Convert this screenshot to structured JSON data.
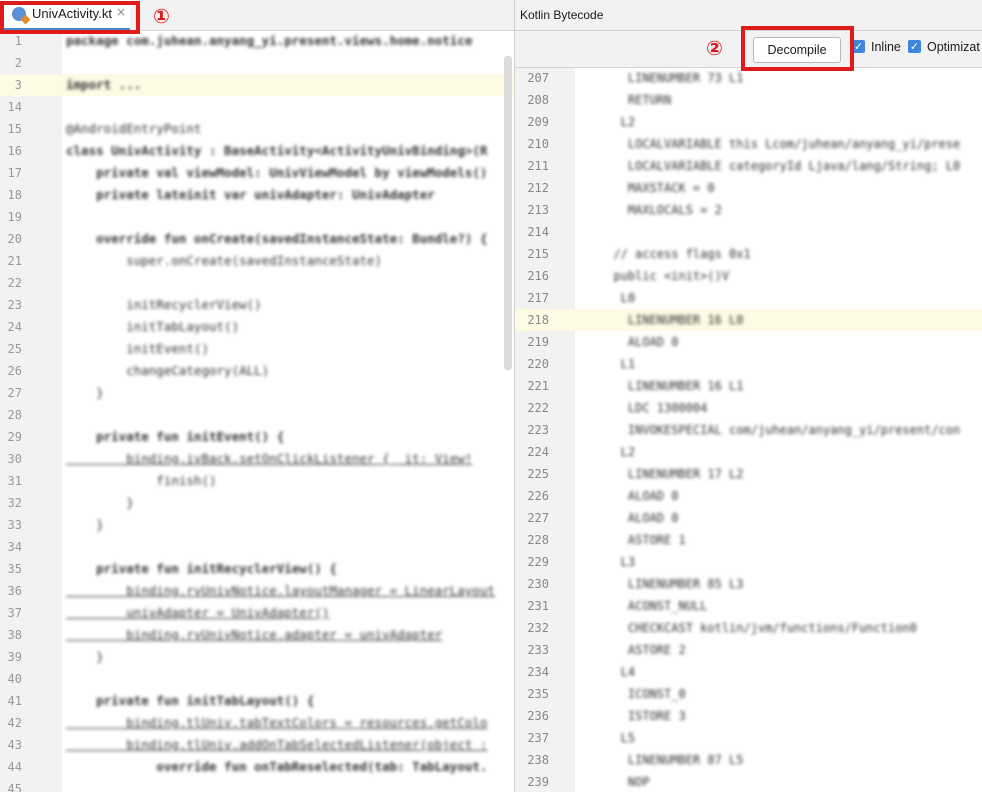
{
  "editor": {
    "tab_label": "UnivActivity.kt",
    "tab_close": "×",
    "lines": [
      {
        "n": "1",
        "code": "package com.juhean.anyang_yi.present.views.home.notice",
        "kind": "kw"
      },
      {
        "n": "2",
        "code": "",
        "kind": ""
      },
      {
        "n": "3",
        "code": "import ...",
        "kind": "kw",
        "hl": true
      },
      {
        "n": "14",
        "code": "",
        "kind": ""
      },
      {
        "n": "15",
        "code": "@AndroidEntryPoint",
        "kind": "cm"
      },
      {
        "n": "16",
        "code": "class UnivActivity : BaseActivity<ActivityUnivBinding>(R",
        "kind": "kw"
      },
      {
        "n": "17",
        "code": "    private val viewModel: UnivViewModel by viewModels()",
        "kind": "kw"
      },
      {
        "n": "18",
        "code": "    private lateinit var univAdapter: UnivAdapter",
        "kind": "kw"
      },
      {
        "n": "19",
        "code": "",
        "kind": ""
      },
      {
        "n": "20",
        "code": "    override fun onCreate(savedInstanceState: Bundle?) {",
        "kind": "kw"
      },
      {
        "n": "21",
        "code": "        super.onCreate(savedInstanceState)",
        "kind": "fn"
      },
      {
        "n": "22",
        "code": "",
        "kind": ""
      },
      {
        "n": "23",
        "code": "        initRecyclerView()",
        "kind": ""
      },
      {
        "n": "24",
        "code": "        initTabLayout()",
        "kind": ""
      },
      {
        "n": "25",
        "code": "        initEvent()",
        "kind": ""
      },
      {
        "n": "26",
        "code": "        changeCategory(ALL)",
        "kind": ""
      },
      {
        "n": "27",
        "code": "    }",
        "kind": ""
      },
      {
        "n": "28",
        "code": "",
        "kind": ""
      },
      {
        "n": "29",
        "code": "    private fun initEvent() {",
        "kind": "kw"
      },
      {
        "n": "30",
        "code": "        binding.ivBack.setOnClickListener {  it: View!",
        "kind": "pp"
      },
      {
        "n": "31",
        "code": "            finish()",
        "kind": ""
      },
      {
        "n": "32",
        "code": "        }",
        "kind": ""
      },
      {
        "n": "33",
        "code": "    }",
        "kind": ""
      },
      {
        "n": "34",
        "code": "",
        "kind": ""
      },
      {
        "n": "35",
        "code": "    private fun initRecyclerView() {",
        "kind": "kw"
      },
      {
        "n": "36",
        "code": "        binding.rvUnivNotice.layoutManager = LinearLayout",
        "kind": "pp"
      },
      {
        "n": "37",
        "code": "        univAdapter = UnivAdapter()",
        "kind": "pp"
      },
      {
        "n": "38",
        "code": "        binding.rvUnivNotice.adapter = univAdapter",
        "kind": "pp"
      },
      {
        "n": "39",
        "code": "    }",
        "kind": ""
      },
      {
        "n": "40",
        "code": "",
        "kind": ""
      },
      {
        "n": "41",
        "code": "    private fun initTabLayout() {",
        "kind": "kw"
      },
      {
        "n": "42",
        "code": "        binding.tlUniv.tabTextColors = resources.getColo",
        "kind": "pp"
      },
      {
        "n": "43",
        "code": "        binding.tlUniv.addOnTabSelectedListener(object :",
        "kind": "pp"
      },
      {
        "n": "44",
        "code": "            override fun onTabReselected(tab: TabLayout.",
        "kind": "kw"
      },
      {
        "n": "45",
        "code": "",
        "kind": ""
      }
    ]
  },
  "bytecode_panel": {
    "title": "Kotlin Bytecode",
    "decompile_label": "Decompile",
    "inline_label": "Inline",
    "optimization_label": "Optimizat",
    "lines": [
      {
        "n": "207",
        "code": "    LINENUMBER 73 L1"
      },
      {
        "n": "208",
        "code": "    RETURN"
      },
      {
        "n": "209",
        "code": "   L2"
      },
      {
        "n": "210",
        "code": "    LOCALVARIABLE this Lcom/juhean/anyang_yi/prese"
      },
      {
        "n": "211",
        "code": "    LOCALVARIABLE categoryId Ljava/lang/String; L0"
      },
      {
        "n": "212",
        "code": "    MAXSTACK = 0"
      },
      {
        "n": "213",
        "code": "    MAXLOCALS = 2"
      },
      {
        "n": "214",
        "code": ""
      },
      {
        "n": "215",
        "code": "  // access flags 0x1"
      },
      {
        "n": "216",
        "code": "  public <init>()V"
      },
      {
        "n": "217",
        "code": "   L0"
      },
      {
        "n": "218",
        "code": "    LINENUMBER 16 L0",
        "hl": true
      },
      {
        "n": "219",
        "code": "    ALOAD 0"
      },
      {
        "n": "220",
        "code": "   L1"
      },
      {
        "n": "221",
        "code": "    LINENUMBER 16 L1"
      },
      {
        "n": "222",
        "code": "    LDC 1300004"
      },
      {
        "n": "223",
        "code": "    INVOKESPECIAL com/juhean/anyang_yi/present/con"
      },
      {
        "n": "224",
        "code": "   L2"
      },
      {
        "n": "225",
        "code": "    LINENUMBER 17 L2"
      },
      {
        "n": "226",
        "code": "    ALOAD 0"
      },
      {
        "n": "227",
        "code": "    ALOAD 0"
      },
      {
        "n": "228",
        "code": "    ASTORE 1"
      },
      {
        "n": "229",
        "code": "   L3"
      },
      {
        "n": "230",
        "code": "    LINENUMBER 85 L3"
      },
      {
        "n": "231",
        "code": "    ACONST_NULL"
      },
      {
        "n": "232",
        "code": "    CHECKCAST kotlin/jvm/functions/Function0"
      },
      {
        "n": "233",
        "code": "    ASTORE 2"
      },
      {
        "n": "234",
        "code": "   L4"
      },
      {
        "n": "235",
        "code": "    ICONST_0"
      },
      {
        "n": "236",
        "code": "    ISTORE 3"
      },
      {
        "n": "237",
        "code": "   L5"
      },
      {
        "n": "238",
        "code": "    LINENUMBER 87 L5"
      },
      {
        "n": "239",
        "code": "    NOP"
      }
    ]
  },
  "annotations": {
    "step1": "①",
    "step2": "②",
    "color": "#e01b1b"
  }
}
